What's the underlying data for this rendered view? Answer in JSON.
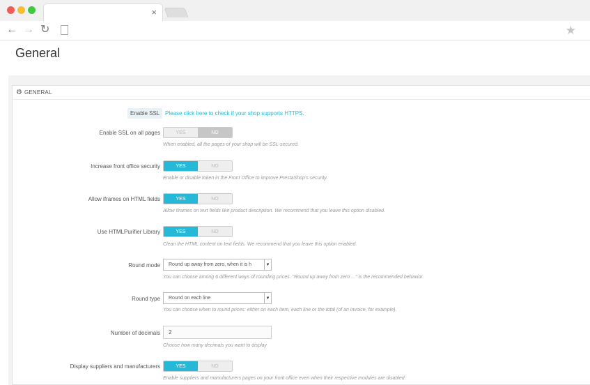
{
  "browser": {
    "tab_close": "×",
    "icons": {
      "back": "arrow-left-icon",
      "forward": "arrow-right-icon",
      "reload": "reload-icon",
      "page": "page-icon",
      "bookmark": "star-icon"
    }
  },
  "page": {
    "title": "General"
  },
  "panel": {
    "heading": "GENERAL",
    "icon": "cogs-icon"
  },
  "ssl": {
    "label": "Enable SSL",
    "link": "Please click here to check if your shop supports HTTPS."
  },
  "switch_labels": {
    "yes": "YES",
    "no": "NO"
  },
  "fields": {
    "ssl_all": {
      "label": "Enable SSL on all pages",
      "value": "NO",
      "help": "When enabled, all the pages of your shop will be SSL-secured."
    },
    "front_security": {
      "label": "Increase front office security",
      "value": "YES",
      "help": "Enable or disable token in the Front Office to improve PrestaShop's security."
    },
    "iframes": {
      "label": "Allow iframes on HTML fields",
      "value": "YES",
      "help": "Allow iframes on text fields like product description. We recommend that you leave this option disabled."
    },
    "htmlpurifier": {
      "label": "Use HTMLPurifier Library",
      "value": "YES",
      "help": "Clean the HTML content on text fields. We recommend that you leave this option enabled."
    },
    "round_mode": {
      "label": "Round mode",
      "value": "Round up away from zero, when it is h",
      "help": "You can choose among 6 different ways of rounding prices. \"Round up away from zero ...\" is the recommended behavior."
    },
    "round_type": {
      "label": "Round type",
      "value": "Round on each line",
      "help": "You can choose when to round prices: either on each item, each line or the total (of an invoice, for example)."
    },
    "decimals": {
      "label": "Number of decimals",
      "value": "2",
      "help": "Choose how many decimals you want to display"
    },
    "suppliers": {
      "label": "Display suppliers and manufacturers",
      "value": "YES",
      "help": "Enable suppliers and manufacturers pages on your front office even when their respective modules are disabled."
    }
  },
  "colors": {
    "accent": "#25b9d7",
    "switch_off": "#eeeeee",
    "switch_no_on": "#c6c6c6"
  }
}
